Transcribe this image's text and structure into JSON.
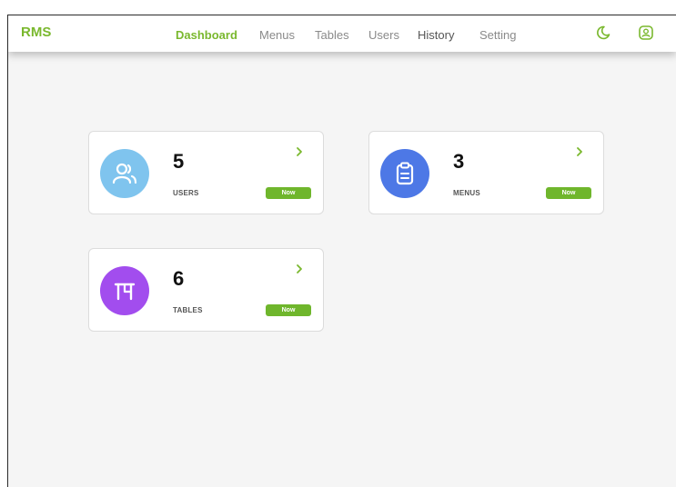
{
  "app": {
    "brand": "RMS"
  },
  "nav": {
    "dashboard": "Dashboard",
    "menus": "Menus",
    "tables": "Tables",
    "users": "Users",
    "history": "History",
    "setting": "Setting"
  },
  "icons": {
    "theme": "moon-icon",
    "profile": "user-circle-icon",
    "users": "users-icon",
    "menus": "clipboard-icon",
    "tables": "table-icon",
    "chevron": "chevron-right-icon"
  },
  "colors": {
    "accent": "#7ab82e",
    "badge": "#6fb62c",
    "users_circle": "#7fc4ee",
    "menus_circle": "#4d78e6",
    "tables_circle": "#a24dee"
  },
  "cards": {
    "users": {
      "count": "5",
      "label": "USERS",
      "badge": "Now"
    },
    "menus": {
      "count": "3",
      "label": "MENUS",
      "badge": "Now"
    },
    "tables": {
      "count": "6",
      "label": "TABLES",
      "badge": "Now"
    }
  }
}
